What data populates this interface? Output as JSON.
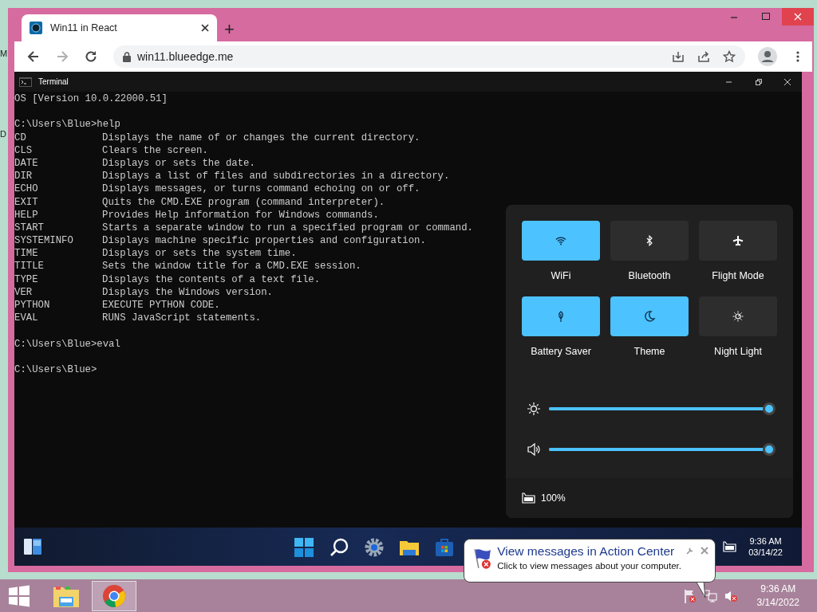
{
  "desktop_labels": [
    "M",
    "D"
  ],
  "browser": {
    "tab": {
      "title": "Win11 in React",
      "selected": true
    },
    "new_tab": "+",
    "nav": [
      {
        "kind": "back",
        "disabled": false
      },
      {
        "kind": "forward",
        "disabled": true
      },
      {
        "kind": "reload",
        "disabled": false
      }
    ],
    "url": "win11.blueedge.me"
  },
  "terminal": {
    "title": "Terminal",
    "lines": [
      {
        "kind": "text",
        "text": "OS [Version 10.0.22000.51]"
      },
      {
        "kind": "blank"
      },
      {
        "kind": "text",
        "text": "C:\\Users\\Blue>help"
      },
      {
        "kind": "command",
        "name": "CD",
        "description": "Displays the name of or changes the current directory."
      },
      {
        "kind": "command",
        "name": "CLS",
        "description": "Clears the screen."
      },
      {
        "kind": "command",
        "name": "DATE",
        "description": "Displays or sets the date."
      },
      {
        "kind": "command",
        "name": "DIR",
        "description": "Displays a list of files and subdirectories in a directory."
      },
      {
        "kind": "command",
        "name": "ECHO",
        "description": "Displays messages, or turns command echoing on or off."
      },
      {
        "kind": "command",
        "name": "EXIT",
        "description": "Quits the CMD.EXE program (command interpreter)."
      },
      {
        "kind": "command",
        "name": "HELP",
        "description": "Provides Help information for Windows commands."
      },
      {
        "kind": "command",
        "name": "START",
        "description": "Starts a separate window to run a specified program or command."
      },
      {
        "kind": "command",
        "name": "SYSTEMINFO",
        "description": "Displays machine specific properties and configuration."
      },
      {
        "kind": "command",
        "name": "TIME",
        "description": "Displays or sets the system time."
      },
      {
        "kind": "command",
        "name": "TITLE",
        "description": "Sets the window title for a CMD.EXE session."
      },
      {
        "kind": "command",
        "name": "TYPE",
        "description": "Displays the contents of a text file."
      },
      {
        "kind": "command",
        "name": "VER",
        "description": "Displays the Windows version."
      },
      {
        "kind": "command",
        "name": "PYTHON",
        "description": "EXECUTE PYTHON CODE."
      },
      {
        "kind": "command",
        "name": "EVAL",
        "description": "RUNS JavaScript statements."
      },
      {
        "kind": "blank"
      },
      {
        "kind": "text",
        "text": "C:\\Users\\Blue>eval"
      },
      {
        "kind": "blank"
      },
      {
        "kind": "text",
        "text": "C:\\Users\\Blue>"
      }
    ]
  },
  "quick_settings": {
    "toggles": [
      {
        "kind": "wifi",
        "label": "WiFi",
        "on": true
      },
      {
        "kind": "bluetooth",
        "label": "Bluetooth",
        "on": false
      },
      {
        "kind": "flight",
        "label": "Flight Mode",
        "on": false
      },
      {
        "kind": "battery",
        "label": "Battery Saver",
        "on": true
      },
      {
        "kind": "theme",
        "label": "Theme",
        "on": true
      },
      {
        "kind": "night",
        "label": "Night Light",
        "on": false
      }
    ],
    "sliders": [
      {
        "kind": "brightness",
        "level": 0.98
      },
      {
        "kind": "volume",
        "level": 0.98
      }
    ],
    "battery": "100%"
  },
  "win11_taskbar": {
    "time": "9:36 AM",
    "date": "03/14/22"
  },
  "host_taskbar": {
    "apps": [
      {
        "kind": "explorer",
        "selected": false
      },
      {
        "kind": "browser",
        "selected": true
      }
    ],
    "time": "9:36 AM",
    "date": "3/14/2022"
  },
  "notification": {
    "title": "View messages in Action Center",
    "message": "Click to view messages about your computer."
  }
}
